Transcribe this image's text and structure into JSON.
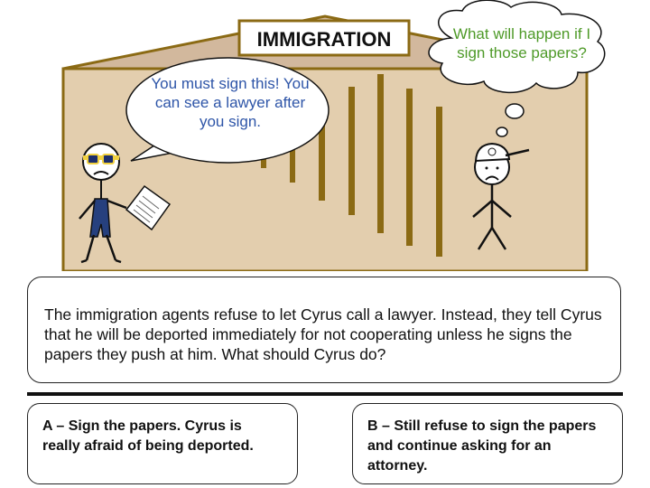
{
  "scene": {
    "building_sign": "IMMIGRATION",
    "agent_speech": "You must sign this! You can see a lawyer after you sign.",
    "cyrus_thought": "What will happen if I sign those papers?"
  },
  "story": {
    "text": "The immigration agents refuse to let Cyrus call a lawyer. Instead, they tell Cyrus that he will be deported immediately for not cooperating unless he signs the papers they push at him. What should Cyrus do?"
  },
  "choices": [
    {
      "label": "A – Sign the papers. Cyrus is really afraid of being deported."
    },
    {
      "label": "B – Still refuse to sign the papers and continue asking for an attorney."
    }
  ],
  "colors": {
    "wall": "#e3ceae",
    "roof": "#d2b89d",
    "trim": "#8b6a14",
    "agent_text": "#2e55a8",
    "thought_text": "#4e9a28"
  }
}
